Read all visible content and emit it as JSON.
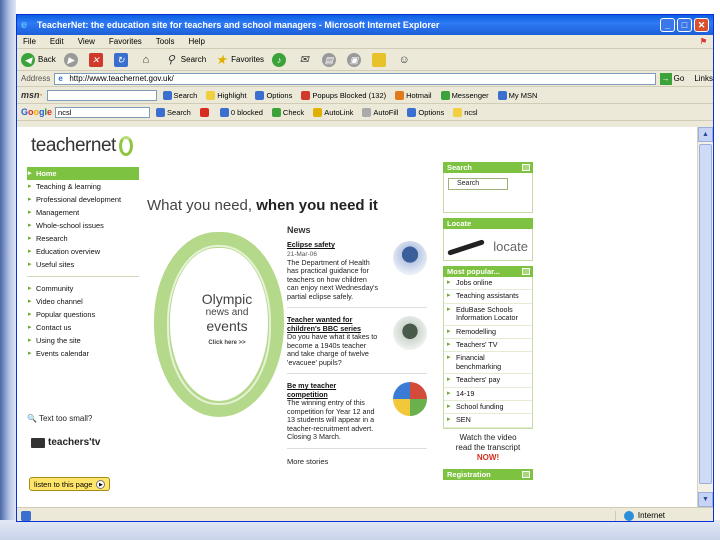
{
  "window": {
    "title": "TeacherNet: the education site for teachers and school managers - Microsoft Internet Explorer",
    "minimize": "_",
    "maximize": "□",
    "close": "✕"
  },
  "menu": [
    "File",
    "Edit",
    "View",
    "Favorites",
    "Tools",
    "Help"
  ],
  "toolbar": {
    "back": "Back",
    "search": "Search",
    "favorites": "Favorites"
  },
  "address": {
    "label": "Address",
    "url": "http://www.teachernet.gov.uk/",
    "go": "Go",
    "links": "Links"
  },
  "msn_bar": {
    "logo_prefix": "msn",
    "search": "Search",
    "highlight": "Highlight",
    "options": "Options",
    "popups": "Popups Blocked (132)",
    "hotmail": "Hotmail",
    "messenger": "Messenger",
    "my_msn": "My MSN"
  },
  "google_bar": {
    "query": "ncsl",
    "search": "Search",
    "blocked": "0 blocked",
    "check": "Check",
    "autolink": "AutoLink",
    "autofill": "AutoFill",
    "options": "Options",
    "highlight_term": "ncsl"
  },
  "site": {
    "logo": "teachernet",
    "nav": [
      "Home",
      "Teaching & learning",
      "Professional development",
      "Management",
      "Whole-school issues",
      "Research",
      "Education overview",
      "Useful sites"
    ],
    "nav2": [
      "Community",
      "Video channel",
      "Popular questions",
      "Contact us",
      "Using the site",
      "Events calendar"
    ],
    "text_small": "Text too small?",
    "teachers_tv": "teachers'tv",
    "listen": "listen to this page"
  },
  "center": {
    "slogan_a": "What you need,",
    "slogan_b": " when you need it",
    "feature": [
      "Olympic",
      "news and",
      "events",
      "Click here >>"
    ]
  },
  "news": {
    "heading": "News",
    "stories": [
      {
        "title": "Eclipse safety",
        "date": "21-Mar-06",
        "body": "The Department of Health has practical guidance for teachers on how children can enjoy next Wednesday's partial eclipse safely."
      },
      {
        "title": "Teacher wanted for children's BBC series",
        "date": "",
        "body": "Do you have what it takes to become a 1940s teacher and take charge of twelve 'evacuee' pupils?"
      },
      {
        "title": "Be my teacher competition",
        "date": "",
        "body": "The winning entry of this competition for Year 12 and 13 students will appear in a teacher-recruitment advert. Closing 3 March."
      }
    ],
    "more": "More stories"
  },
  "right": {
    "search_head": "Search",
    "search_button": "Search",
    "locate_head": "Locate",
    "locate_brand": "locate",
    "popular_head": "Most popular...",
    "popular": [
      "Jobs online",
      "Teaching assistants",
      "EduBase Schools Information Locator",
      "Remodelling",
      "Teachers' TV",
      "Financial benchmarking",
      "Teachers' pay",
      "14-19",
      "School funding",
      "SEN"
    ],
    "watch_1": "Watch the video",
    "watch_2": "read the transcript",
    "watch_now": "NOW!",
    "registration_head": "Registration"
  },
  "status": {
    "zone": "Internet"
  }
}
